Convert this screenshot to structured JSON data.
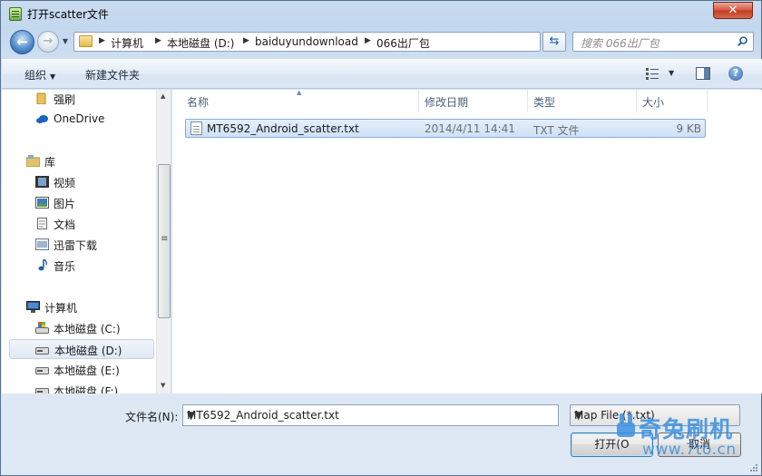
{
  "window": {
    "title": "打开scatter文件",
    "close_label": "✕"
  },
  "address": {
    "crumbs": [
      "计算机",
      "本地磁盘 (D:)",
      "baiduyundownload",
      "066出厂包"
    ]
  },
  "search": {
    "placeholder": "搜索 066出厂包"
  },
  "toolbar": {
    "organize": "组织",
    "new_folder": "新建文件夹",
    "help": "?"
  },
  "sidebar": {
    "items": [
      {
        "label": "强刷",
        "icon": "folder-icon"
      },
      {
        "label": "OneDrive",
        "icon": "cloud-icon"
      },
      {
        "label": "库",
        "icon": "library-icon"
      },
      {
        "label": "视频",
        "icon": "video-icon"
      },
      {
        "label": "图片",
        "icon": "picture-icon"
      },
      {
        "label": "文档",
        "icon": "document-icon"
      },
      {
        "label": "迅雷下载",
        "icon": "download-icon"
      },
      {
        "label": "音乐",
        "icon": "music-icon"
      },
      {
        "label": "计算机",
        "icon": "computer-icon"
      },
      {
        "label": "本地磁盘 (C:)",
        "icon": "system-drive-icon"
      },
      {
        "label": "本地磁盘 (D:)",
        "icon": "drive-icon",
        "selected": true
      },
      {
        "label": "本地磁盘 (E:)",
        "icon": "drive-icon"
      },
      {
        "label": "本地磁盘 (F:)",
        "icon": "drive-icon"
      }
    ]
  },
  "filelist": {
    "columns": [
      "名称",
      "修改日期",
      "类型",
      "大小"
    ],
    "rows": [
      {
        "name": "MT6592_Android_scatter.txt",
        "date": "2014/4/11 14:41",
        "type": "TXT 文件",
        "size": "9 KB"
      }
    ]
  },
  "footer": {
    "filename_label": "文件名(N):",
    "filename_value": "MT6592_Android_scatter.txt",
    "filter_value": "Map File (*.txt)",
    "open_label": "打开(O",
    "cancel_label": "取消"
  },
  "watermark": {
    "text": "奇兔刷机",
    "url": "www.7to.cn"
  },
  "colors": {
    "accent": "#3a8fe0",
    "selection": "#cde1f7",
    "close": "#c23d23"
  }
}
